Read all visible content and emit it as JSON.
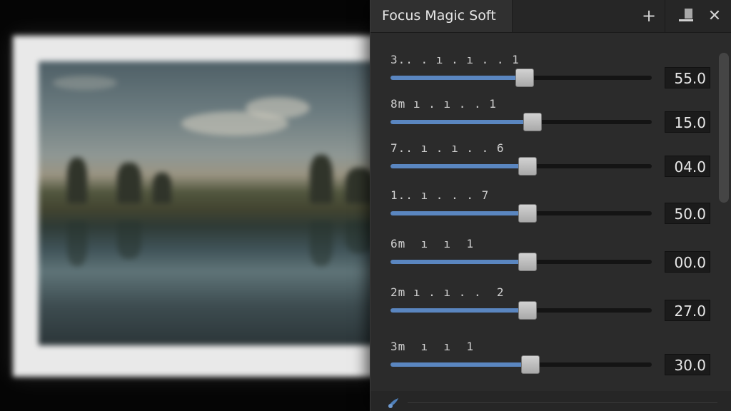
{
  "window": {
    "title": "Focus Magic Soft",
    "add_icon": "plus-icon",
    "minimize_icon": "minimize-icon",
    "close_icon": "close-icon"
  },
  "sliders": [
    {
      "label": "3.. . ı . ı . . 1",
      "value": "55.0",
      "level": 0.49
    },
    {
      "label": "8m ı . ı . . 1",
      "value": "15.0",
      "level": 0.52
    },
    {
      "label": "7.. ı . ı . . 6",
      "value": "04.0",
      "level": 0.5
    },
    {
      "label": "1.. ı . . . 7",
      "value": "50.0",
      "level": 0.5
    },
    {
      "label": "6m  ı  ı  1",
      "value": "00.0",
      "level": 0.5
    },
    {
      "label": "2m ı . ı . .  2",
      "value": "27.0",
      "level": 0.5
    },
    {
      "label": "3m  ı  ı  1",
      "value": "30.0",
      "level": 0.51
    }
  ],
  "colors": {
    "accent": "#5a86c0",
    "panel_bg": "#2b2b2b",
    "track": "#141414"
  },
  "footer": {
    "icon": "brush-icon"
  }
}
